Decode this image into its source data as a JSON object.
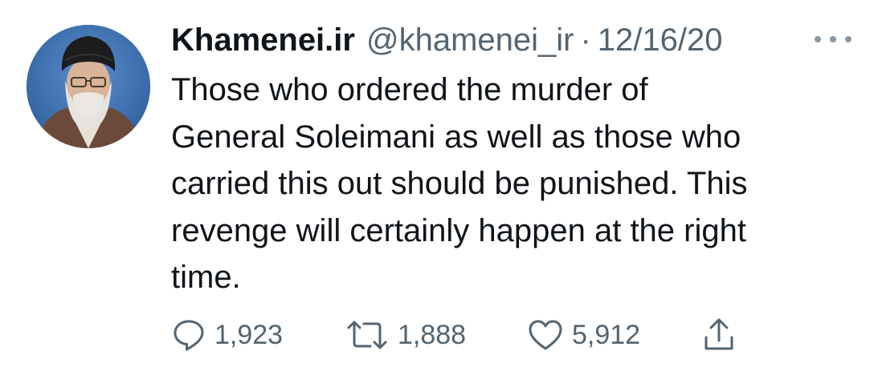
{
  "tweet": {
    "display_name": "Khamenei.ir",
    "handle": "@khamenei_ir",
    "separator": "·",
    "date": "12/16/20",
    "text_lines": [
      "Those who ordered the murder of",
      "General Soleimani as well as those who",
      "carried this out should be punished. This",
      "revenge will certainly happen at the right",
      "time."
    ],
    "avatar_icon": "profile-photo",
    "more_icon": "more-dots-icon"
  },
  "actions": {
    "reply": {
      "icon": "reply-icon",
      "count": "1,923"
    },
    "retweet": {
      "icon": "retweet-icon",
      "count": "1,888"
    },
    "like": {
      "icon": "heart-icon",
      "count": "5,912"
    },
    "share": {
      "icon": "share-icon"
    }
  },
  "colors": {
    "text": "#0f1419",
    "secondary": "#536471",
    "avatar_background": "#3f6fae"
  }
}
